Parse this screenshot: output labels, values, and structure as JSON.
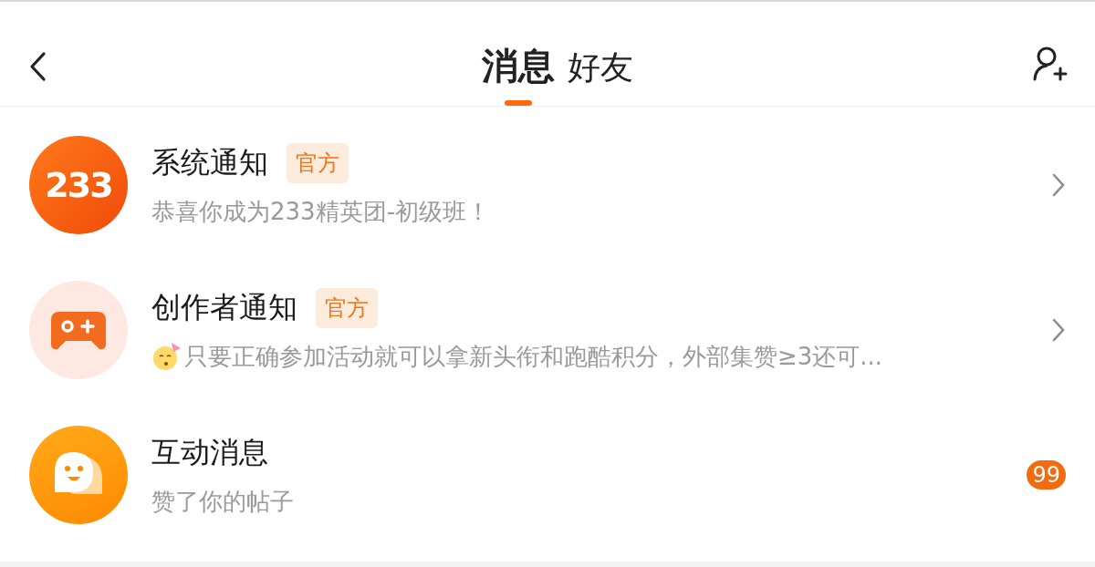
{
  "header": {
    "tabs": [
      {
        "label": "消息",
        "selected": true
      },
      {
        "label": "好友",
        "selected": false
      }
    ]
  },
  "conversations": [
    {
      "kind": "system",
      "avatar_text": "233",
      "title": "系统通知",
      "tag": "官方",
      "preview": "恭喜你成为233精英团-初级班！"
    },
    {
      "kind": "creator",
      "title": "创作者通知",
      "tag": "官方",
      "preview": "只要正确参加活动就可以拿新头衔和跑酷积分，外部集赞≥3还可..."
    },
    {
      "kind": "interaction",
      "title": "互动消息",
      "preview": "赞了你的帖子",
      "badge": "99"
    }
  ]
}
